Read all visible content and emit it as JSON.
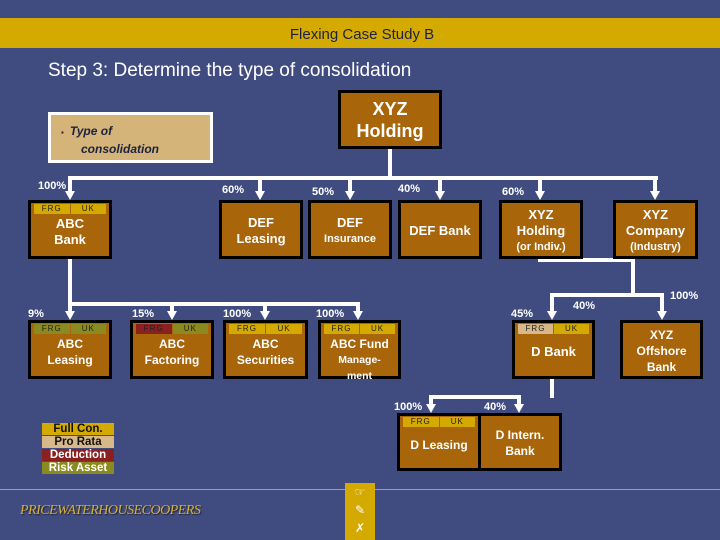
{
  "header": {
    "title": "Flexing Case Study B"
  },
  "subtitle": "Step 3: Determine the type of consolidation",
  "note": {
    "bullet": "▪",
    "text_line1": "Type of",
    "text_line2": "consolidation"
  },
  "colors": {
    "background": "#404c80",
    "band": "#d4aa00",
    "entity_box": "#a8650a",
    "full_con": "#d4aa00",
    "pro_rata": "#d8b888",
    "deduction": "#8b2020",
    "risk_asset": "#8b8a20"
  },
  "root": {
    "line1": "XYZ",
    "line2": "Holding"
  },
  "tag_labels": {
    "frg": "FRG",
    "uk": "UK"
  },
  "entities": {
    "abc_bank": {
      "l1": "ABC",
      "l2": "Bank",
      "pct": "100%",
      "frg": "Full Con.",
      "uk": "Full Con."
    },
    "def_leasing": {
      "l1": "DEF",
      "l2": "Leasing",
      "pct": "60%"
    },
    "def_insurance": {
      "l1": "DEF",
      "l2": "Insurance",
      "pct": "50%"
    },
    "def_bank": {
      "l1": "DEF Bank",
      "pct": "40%"
    },
    "xyz_holding_indiv": {
      "l1": "XYZ",
      "l2": "Holding",
      "l3": "(or Indiv.)",
      "pct": "60%"
    },
    "xyz_company": {
      "l1": "XYZ",
      "l2": "Company",
      "l3": "(Industry)"
    },
    "abc_leasing": {
      "l1": "ABC",
      "l2": "Leasing",
      "pct": "9%",
      "frg": "Risk Asset",
      "uk": "Risk Asset"
    },
    "abc_factoring": {
      "l1": "ABC",
      "l2": "Factoring",
      "pct": "15%",
      "frg": "Deduction",
      "uk": "Risk Asset"
    },
    "abc_securities": {
      "l1": "ABC",
      "l2": "Securities",
      "pct": "100%",
      "frg": "Full Con.",
      "uk": "Full Con."
    },
    "abc_fund": {
      "l1": "ABC Fund",
      "l2": "Manage-",
      "l3": "ment",
      "pct": "100%",
      "frg": "Full Con.",
      "uk": "Full Con."
    },
    "d_bank": {
      "l1": "D Bank",
      "pct": "45%",
      "pct2": "40%",
      "frg": "Pro Rata",
      "uk": "Full Con."
    },
    "xyz_offshore": {
      "l1": "XYZ",
      "l2": "Offshore",
      "l3": "Bank",
      "pct": "100%"
    },
    "d_leasing": {
      "l1": "D Leasing",
      "pct": "100%",
      "frg": "Full Con.",
      "uk": "Full Con."
    },
    "d_intern": {
      "l1": "D Intern.",
      "l2": "Bank",
      "pct": "40%"
    }
  },
  "legend": [
    {
      "label": "Full Con.",
      "color": "#d4aa00",
      "text": "#111"
    },
    {
      "label": "Pro Rata",
      "color": "#d8b888",
      "text": "#111"
    },
    {
      "label": "Deduction",
      "color": "#8b2020",
      "text": "#fff"
    },
    {
      "label": "Risk Asset",
      "color": "#8b8a20",
      "text": "#fff"
    }
  ],
  "footer": {
    "logo": "PRICEWATERHOUSECOOPERS",
    "nav_icons": [
      "pointing-hand-icon",
      "pencil-icon",
      "close-icon"
    ],
    "nav_glyphs": [
      "☞",
      "✎",
      "✗"
    ]
  }
}
